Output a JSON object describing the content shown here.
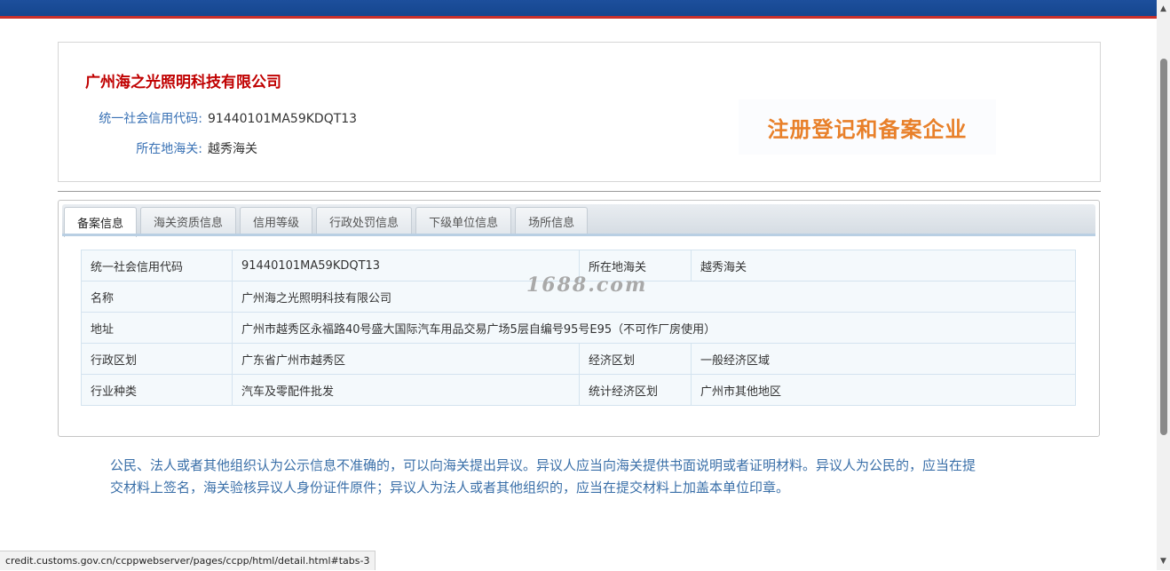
{
  "company": {
    "name": "广州海之光照明科技有限公司",
    "code_label": "统一社会信用代码:",
    "code_value": "91440101MA59KDQT13",
    "customs_label": "所在地海关:",
    "customs_value": "越秀海关",
    "stamp_text": "注册登记和备案企业"
  },
  "tabs": [
    {
      "label": "备案信息",
      "active": true
    },
    {
      "label": "海关资质信息"
    },
    {
      "label": "信用等级"
    },
    {
      "label": "行政处罚信息"
    },
    {
      "label": "下级单位信息"
    },
    {
      "label": "场所信息"
    }
  ],
  "table": {
    "rows": [
      {
        "k1": "统一社会信用代码",
        "v1": "91440101MA59KDQT13",
        "k2": "所在地海关",
        "v2": "越秀海关"
      },
      {
        "k1": "名称",
        "v1": "广州海之光照明科技有限公司"
      },
      {
        "k1": "地址",
        "v1": "广州市越秀区永福路40号盛大国际汽车用品交易广场5层自编号95号E95（不可作厂房使用）"
      },
      {
        "k1": "行政区划",
        "v1": "广东省广州市越秀区",
        "k2": "经济区划",
        "v2": "一般经济区域"
      },
      {
        "k1": "行业种类",
        "v1": "汽车及零配件批发",
        "k2": "统计经济区划",
        "v2": "广州市其他地区"
      }
    ]
  },
  "watermark": "1688.com",
  "notice": {
    "line1": "公民、法人或者其他组织认为公示信息不准确的，可以向海关提出异议。异议人应当向海关提供书面说明或者证明材料。异议人为公民的，应当在提",
    "line2": "交材料上签名，海关验核异议人身份证件原件；异议人为法人或者其他组织的，应当在提交材料上加盖本单位印章。"
  },
  "status_url": "credit.customs.gov.cn/ccppwebserver/pages/ccpp/html/detail.html#tabs-3",
  "icons": {
    "scroll_up": "▲",
    "scroll_down": "▼"
  },
  "colors": {
    "header_bar": "#1d4f9c",
    "accent_red": "#c00000",
    "label_blue": "#3a72b5",
    "stamp_orange": "#e8802a"
  }
}
